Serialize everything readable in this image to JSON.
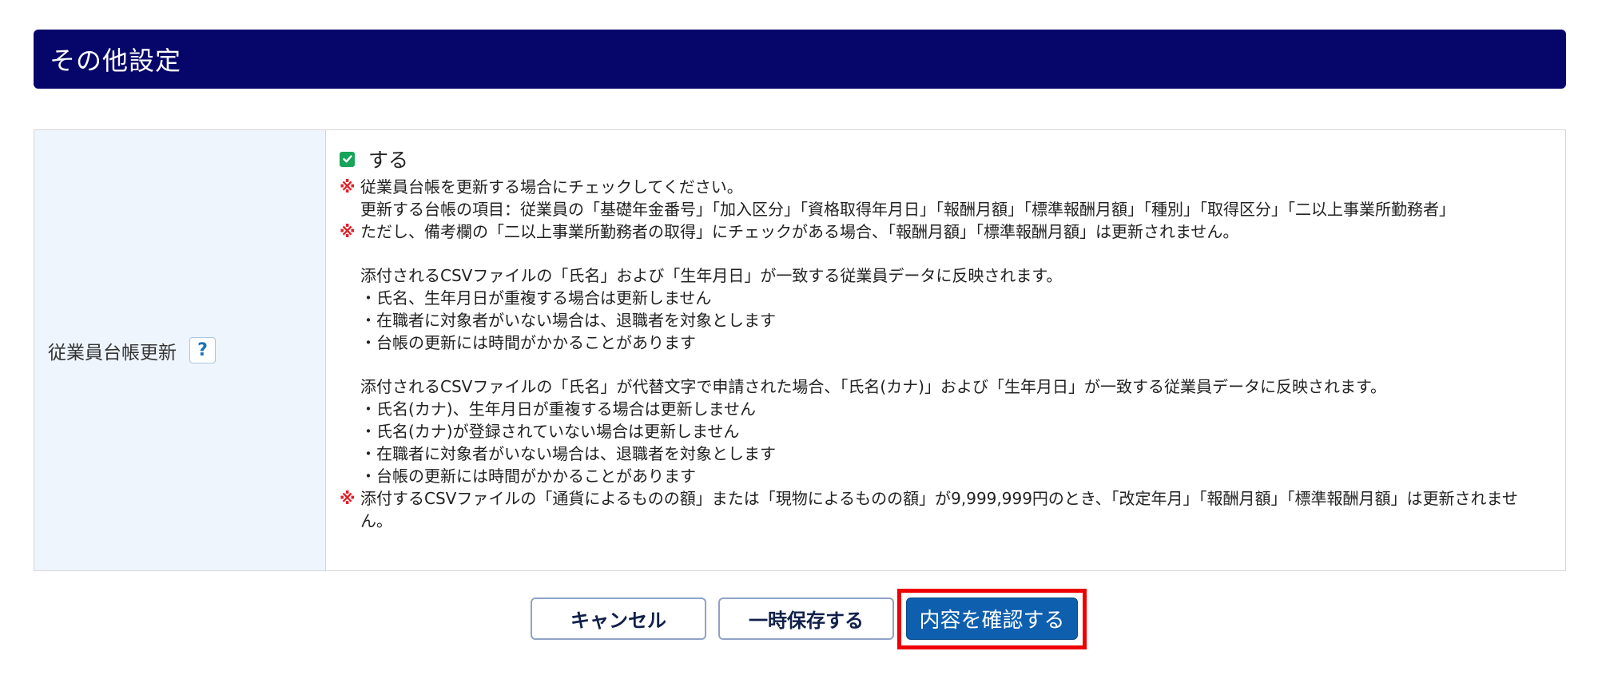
{
  "section": {
    "title": "その他設定"
  },
  "field": {
    "label": "従業員台帳更新",
    "help_label": "?",
    "checkbox_label": "する",
    "checked": true
  },
  "notes": [
    {
      "kind": "mark",
      "text": "従業員台帳を更新する場合にチェックしてください。"
    },
    {
      "kind": "indent",
      "text": "更新する台帳の項目：従業員の「基礎年金番号」「加入区分」「資格取得年月日」「報酬月額」「標準報酬月額」「種別」「取得区分」「二以上事業所勤務者」"
    },
    {
      "kind": "mark",
      "text": "ただし、備考欄の「二以上事業所勤務者の取得」にチェックがある場合、「報酬月額」「標準報酬月額」は更新されません。"
    },
    {
      "kind": "blank",
      "text": ""
    },
    {
      "kind": "indent",
      "text": "添付されるCSVファイルの「氏名」および「生年月日」が一致する従業員データに反映されます。"
    },
    {
      "kind": "indent",
      "text": "・氏名、生年月日が重複する場合は更新しません"
    },
    {
      "kind": "indent",
      "text": "・在職者に対象者がいない場合は、退職者を対象とします"
    },
    {
      "kind": "indent",
      "text": "・台帳の更新には時間がかかることがあります"
    },
    {
      "kind": "blank",
      "text": ""
    },
    {
      "kind": "indent",
      "text": "添付されるCSVファイルの「氏名」が代替文字で申請された場合、「氏名(カナ)」および「生年月日」が一致する従業員データに反映されます。"
    },
    {
      "kind": "indent",
      "text": "・氏名(カナ)、生年月日が重複する場合は更新しません"
    },
    {
      "kind": "indent",
      "text": "・氏名(カナ)が登録されていない場合は更新しません"
    },
    {
      "kind": "indent",
      "text": "・在職者に対象者がいない場合は、退職者を対象とします"
    },
    {
      "kind": "indent",
      "text": "・台帳の更新には時間がかかることがあります"
    },
    {
      "kind": "mark",
      "text": "添付するCSVファイルの「通貨によるものの額」または「現物によるものの額」が9,999,999円のとき、「改定年月」「報酬月額」「標準報酬月額」は更新されません。"
    }
  ],
  "mark_glyph": "※",
  "buttons": {
    "cancel": "キャンセル",
    "save_draft": "一時保存する",
    "confirm": "内容を確認する"
  },
  "colors": {
    "header_bg": "#06066a",
    "label_cell_bg": "#eef5fc",
    "checkbox_green": "#17a35a",
    "mark_red": "#e0202a",
    "confirm_bg": "#0e5fae",
    "highlight_red": "#ee0000"
  }
}
